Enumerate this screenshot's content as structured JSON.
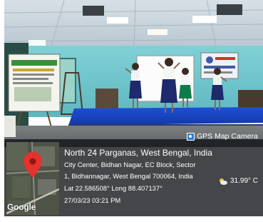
{
  "stamp": {
    "app_name": "GPS Map Camera",
    "location_title": "North 24 Parganas, West Bengal, India",
    "address_line_1": "City Center, Bidhan Nagar, EC Block, Sector",
    "address_line_2": "1, Bidhannagar, West Bengal 700064, India",
    "coordinates": "Lat 22.586508° Long 88.407137°",
    "datetime": "27/03/23 03:21 PM",
    "temperature": "31.99° C",
    "map_brand": "Google"
  },
  "icons": {
    "map_pin": "map-pin-icon",
    "weather": "partly-cloudy-icon",
    "app": "camera-icon"
  }
}
